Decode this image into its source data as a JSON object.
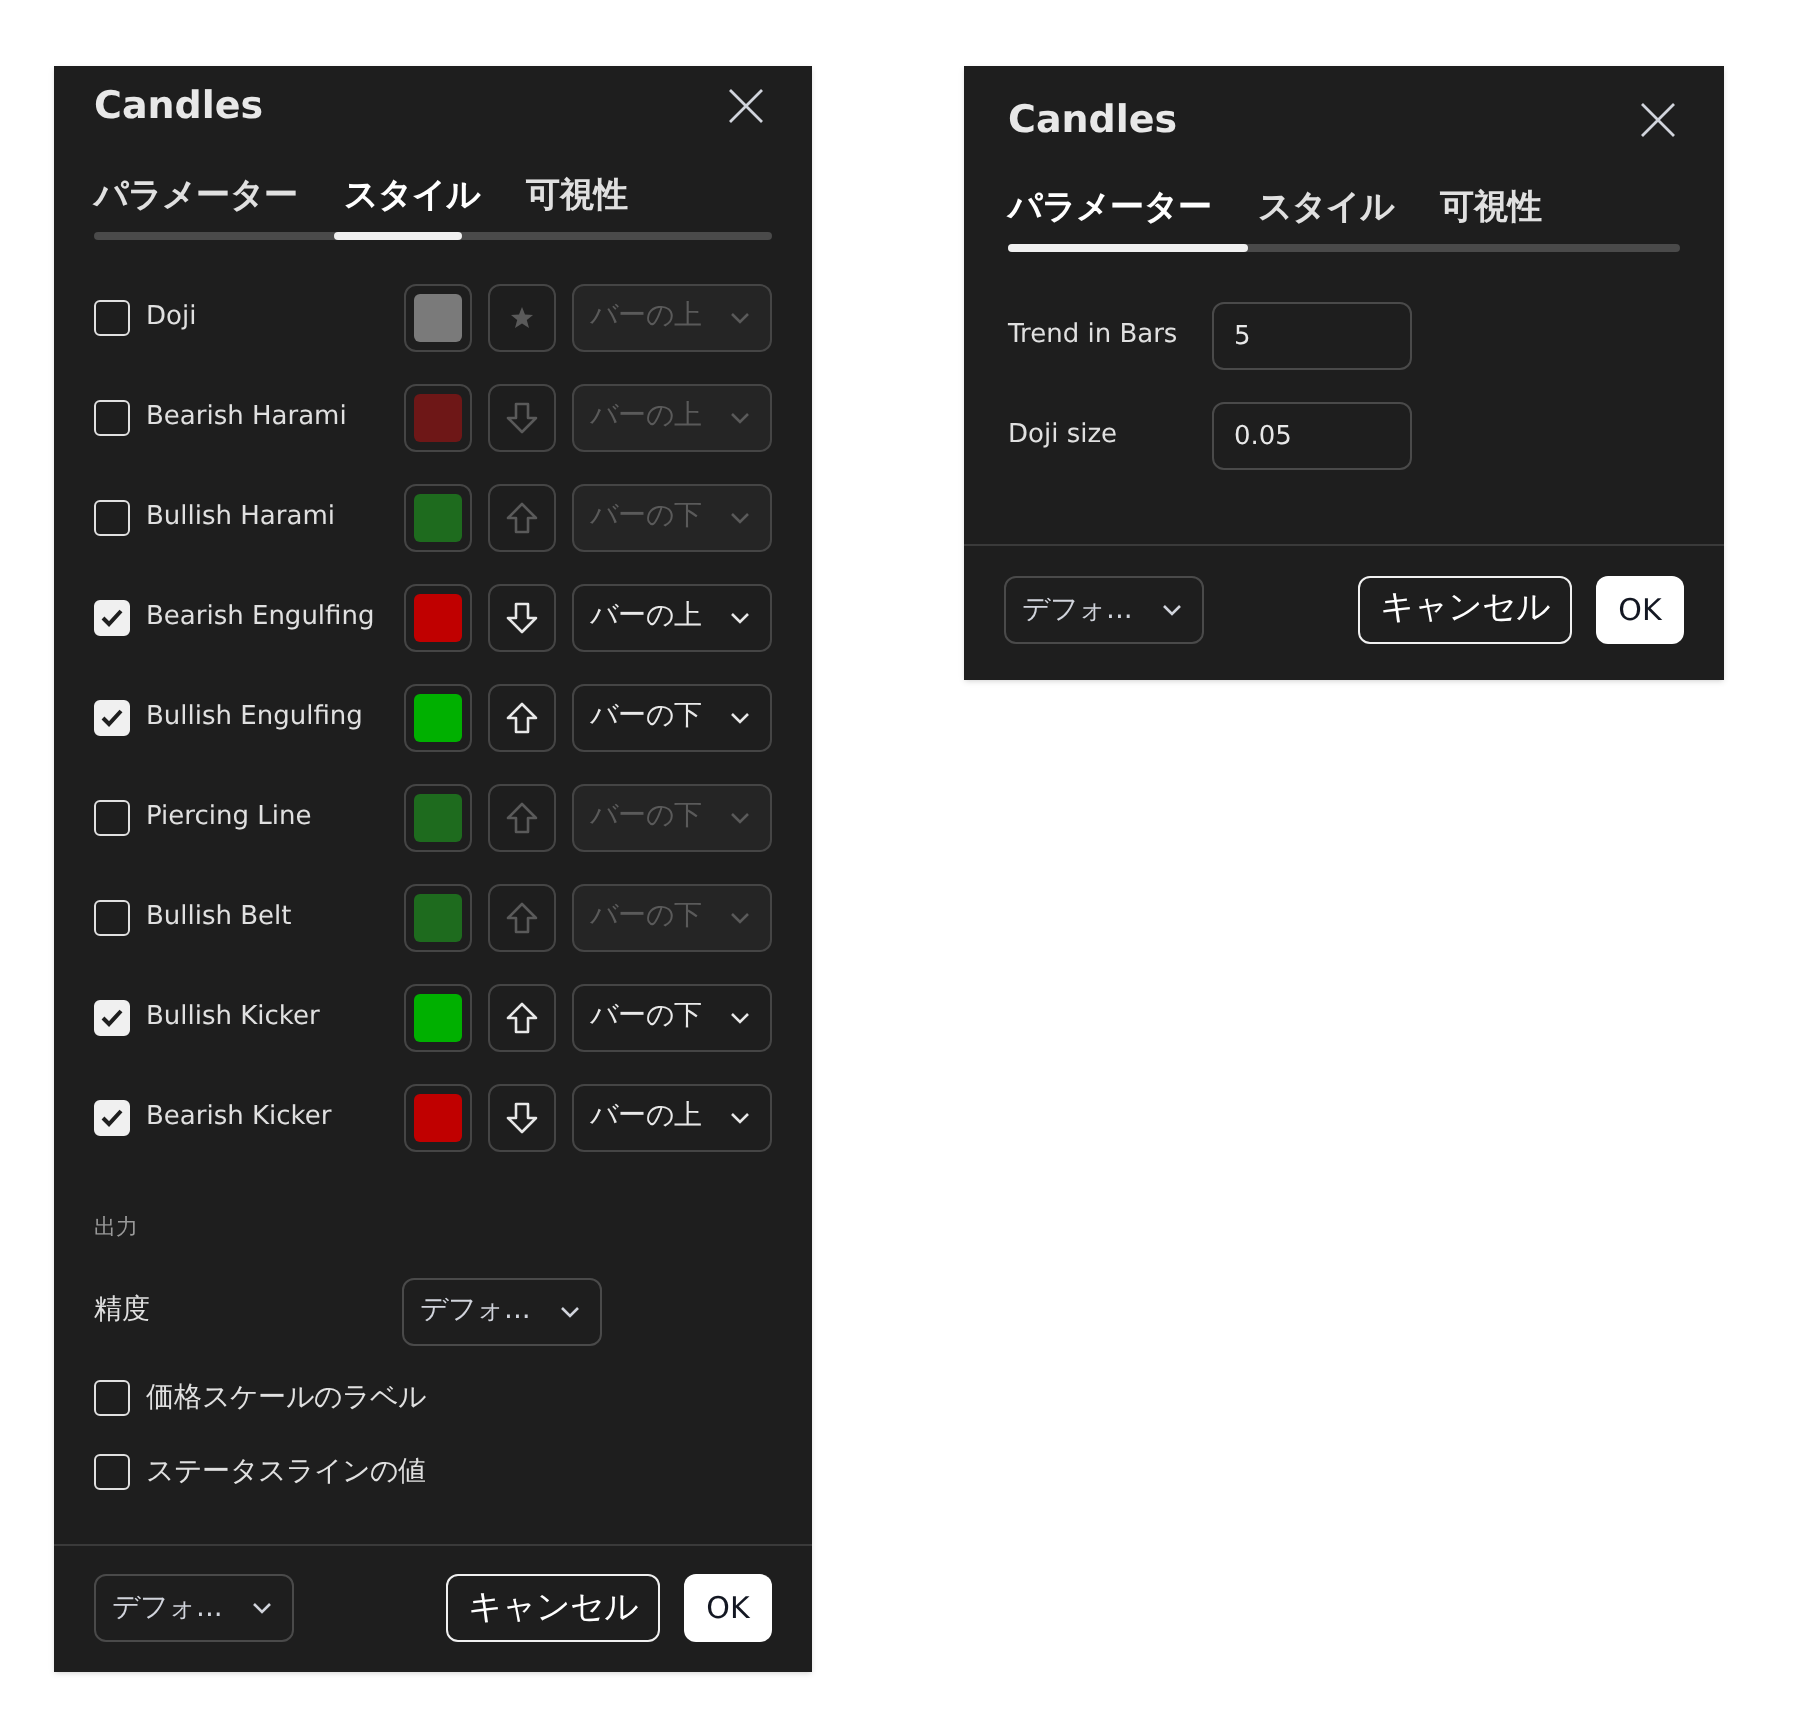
{
  "style_dialog": {
    "title": "Candles",
    "tabs": [
      {
        "label": "パラメーター",
        "selected": false
      },
      {
        "label": "スタイル",
        "selected": true
      },
      {
        "label": "可視性",
        "selected": false
      }
    ],
    "patterns": [
      {
        "label": "Doji",
        "checked": false,
        "color": "#7a7a7a",
        "kind": "star",
        "placement": "バーの上"
      },
      {
        "label": "Bearish Harami",
        "checked": false,
        "color": "#6e1717",
        "kind": "arrow_down",
        "placement": "バーの上"
      },
      {
        "label": "Bullish Harami",
        "checked": false,
        "color": "#1e6b1e",
        "kind": "arrow_up",
        "placement": "バーの下"
      },
      {
        "label": "Bearish Engulfing",
        "checked": true,
        "color": "#c00000",
        "kind": "arrow_down",
        "placement": "バーの上"
      },
      {
        "label": "Bullish Engulfing",
        "checked": true,
        "color": "#00b000",
        "kind": "arrow_up",
        "placement": "バーの下"
      },
      {
        "label": "Piercing Line",
        "checked": false,
        "color": "#1e6b1e",
        "kind": "arrow_up",
        "placement": "バーの下"
      },
      {
        "label": "Bullish Belt",
        "checked": false,
        "color": "#1e6b1e",
        "kind": "arrow_up",
        "placement": "バーの下"
      },
      {
        "label": "Bullish Kicker",
        "checked": true,
        "color": "#00b000",
        "kind": "arrow_up",
        "placement": "バーの下"
      },
      {
        "label": "Bearish Kicker",
        "checked": true,
        "color": "#c00000",
        "kind": "arrow_down",
        "placement": "バーの上"
      }
    ],
    "output": {
      "heading": "出力",
      "precision_label": "精度",
      "precision_value": "デフォ...",
      "options": [
        {
          "label": "価格スケールのラベル",
          "checked": false
        },
        {
          "label": "ステータスラインの値",
          "checked": false
        }
      ]
    },
    "footer": {
      "template": "デフォ...",
      "cancel": "キャンセル",
      "ok": "OK"
    }
  },
  "parameters_dialog": {
    "title": "Candles",
    "tabs": [
      {
        "label": "パラメーター",
        "selected": true
      },
      {
        "label": "スタイル",
        "selected": false
      },
      {
        "label": "可視性",
        "selected": false
      }
    ],
    "fields": [
      {
        "label": "Trend in Bars",
        "value": "5"
      },
      {
        "label": "Doji size",
        "value": "0.05"
      }
    ],
    "footer": {
      "template": "デフォ...",
      "cancel": "キャンセル",
      "ok": "OK"
    }
  }
}
